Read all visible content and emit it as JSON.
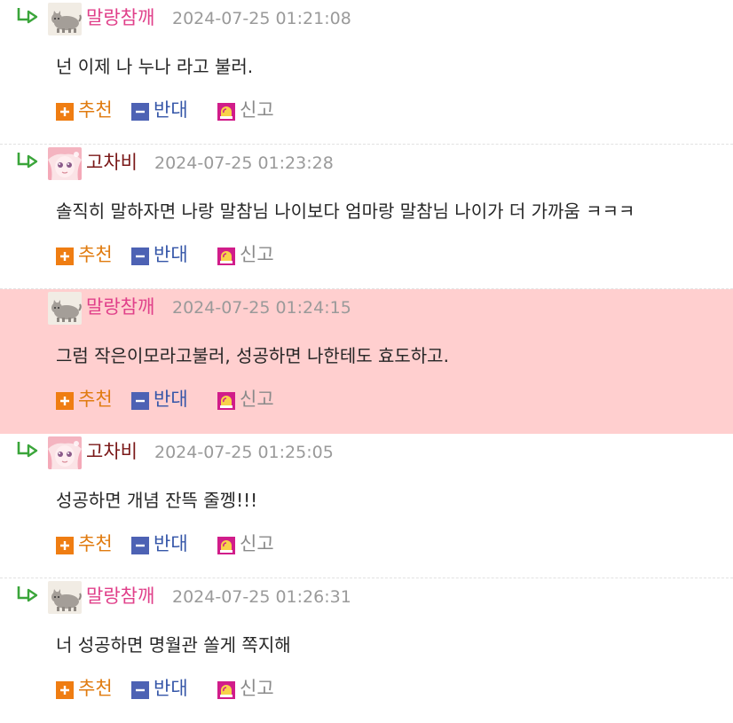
{
  "labels": {
    "recommend": "추천",
    "oppose": "반대",
    "report": "신고"
  },
  "colors": {
    "highlight_bg": "#ffcfcf",
    "author_pink": "#e0408a",
    "author_dark_red": "#7a1818",
    "recommend": "#e07b10",
    "oppose": "#3556a8",
    "report": "#8a8a8a"
  },
  "comments": [
    {
      "author": "말랑참깨",
      "author_color": "#e0408a",
      "avatar": "cat-avatar",
      "date": "2024-07-25 01:21:08",
      "text": "넌 이제 나 누나 라고 불러.",
      "is_reply": true,
      "highlighted": false
    },
    {
      "author": "고차비",
      "author_color": "#7a1818",
      "avatar": "anime-girl-avatar",
      "date": "2024-07-25 01:23:28",
      "text": "솔직히 말하자면 나랑 말참님 나이보다 엄마랑 말참님 나이가 더 가까움 ㅋㅋㅋ",
      "is_reply": true,
      "highlighted": false
    },
    {
      "author": "말랑참깨",
      "author_color": "#e0408a",
      "avatar": "cat-avatar",
      "date": "2024-07-25 01:24:15",
      "text": "그럼 작은이모라고불러, 성공하면 나한테도 효도하고.",
      "is_reply": false,
      "highlighted": true
    },
    {
      "author": "고차비",
      "author_color": "#7a1818",
      "avatar": "anime-girl-avatar",
      "date": "2024-07-25 01:25:05",
      "text": "성공하면 개념 잔뜩 줄껭!!!",
      "is_reply": true,
      "highlighted": false
    },
    {
      "author": "말랑참깨",
      "author_color": "#e0408a",
      "avatar": "cat-avatar",
      "date": "2024-07-25 01:26:31",
      "text": "너 성공하면 명월관 쏠게 쪽지해",
      "is_reply": true,
      "highlighted": false
    }
  ]
}
